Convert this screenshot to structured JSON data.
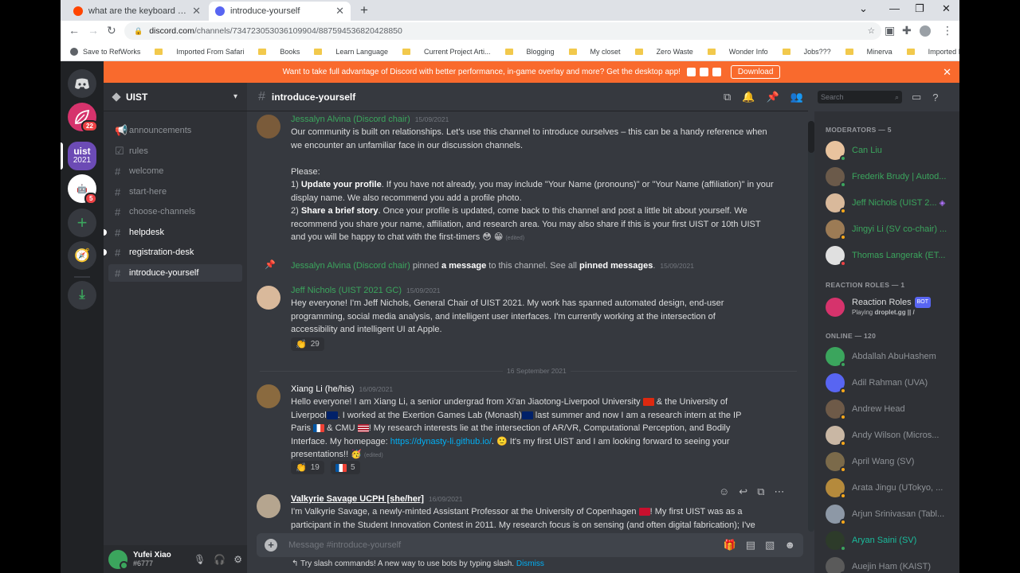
{
  "browser": {
    "tabs": [
      {
        "title": "what are the keyboard short cuts",
        "favicon_color": "#ff4500"
      },
      {
        "title": "introduce-yourself",
        "favicon_color": "#5865f2"
      }
    ],
    "url_host": "discord.com",
    "url_path": "/channels/734723053036109904/887594536820428850",
    "bookmarks": [
      "Save to RefWorks",
      "Imported From Safari",
      "Books",
      "Learn Language",
      "Current Project Arti...",
      "Blogging",
      "My closet",
      "Zero Waste",
      "Wonder Info",
      "Jobs???",
      "Minerva",
      "Imported From Chr..."
    ]
  },
  "banner": {
    "text": "Want to take full advantage of Discord with better performance, in-game overlay and more? Get the desktop app!",
    "download_label": "Download"
  },
  "guilds": {
    "badge_1": "22",
    "uist_line1": "uist",
    "uist_line2": "2021",
    "badge_2": "5"
  },
  "server": {
    "name": "UIST",
    "channels": [
      "announcements",
      "rules",
      "welcome",
      "start-here",
      "choose-channels",
      "helpdesk",
      "registration-desk",
      "introduce-yourself"
    ]
  },
  "user": {
    "name": "Yufei Xiao",
    "tag": "#6777"
  },
  "channel": {
    "name": "introduce-yourself",
    "search_placeholder": "Search"
  },
  "messages": {
    "m1": {
      "author": "Jessalyn Alvina (Discord chair)",
      "ts": "15/09/2021",
      "p1": "Our community is built on relationships. Let's use this channel to introduce ourselves – this can be a handy reference when we encounter an unfamiliar face in our discussion channels.",
      "please": "Please:",
      "i1_num": "1) ",
      "i1_bold": "Update your profile",
      "i1_rest": ". If you have not already, you may include \"Your Name (pronouns)\" or \"Your Name (affiliation)\" in your display name. We also recommend you add a profile photo.",
      "i2_num": "2) ",
      "i2_bold": "Share a brief story",
      "i2_rest": ". Once your profile is updated, come back to this channel and post a little bit about yourself. We recommend you share your name, affiliation, and research area. You may also share if this is your first UIST or 10th UIST and you will be happy to chat with the first-timers ",
      "edited": "(edited)"
    },
    "pin": {
      "author": "Jessalyn Alvina (Discord chair)",
      "t1": " pinned ",
      "a_message": "a message",
      "t2": " to this channel. See all ",
      "pinned_messages": "pinned messages",
      "t3": ".",
      "ts": "15/09/2021"
    },
    "m2": {
      "author": "Jeff Nichols (UIST 2021 GC)",
      "ts": "15/09/2021",
      "text": "Hey everyone!  I'm Jeff Nichols, General Chair of UIST 2021.   My work has spanned automated design, end-user programming, social media analysis, and intelligent user interfaces.  I'm currently working at the intersection of accessibility and intelligent UI at Apple.",
      "reaction_count": "29"
    },
    "divider_label": "16 September 2021",
    "m3": {
      "author": "Xiang Li (he/his)",
      "ts": "16/09/2021",
      "t1": "Hello everyone! I am Xiang Li, a senior undergrad from Xi'an Jiaotong-Liverpool University ",
      "t2": " & the University of Liverpool",
      "t3": ". I worked at the Exertion Games Lab (Monash)",
      "t4": " last summer and now I am a research intern at the IP Paris ",
      "t5": " & CMU ",
      "t6": "! My research interests lie at the intersection of AR/VR, Computational Perception, and Bodily Interface. My homepage: ",
      "link": "https://dynasty-li.github.io/",
      "t7": ". ",
      "t8": " It's my first UIST and I am looking forward to seeing your presentations!! ",
      "edited": "(edited)",
      "r1": "19",
      "r2": "5"
    },
    "m4": {
      "author": "Valkyrie Savage UCPH [she/her]",
      "ts": "16/09/2021",
      "t1": "I'm Valkyrie Savage, a newly-minted Assistant Professor at the University of Copenhagen ",
      "t2": "! My first UIST was as a participant in the Student Innovation Contest in 2011. My research focus is on sensing (and often digital fabrication); I've"
    }
  },
  "composer": {
    "placeholder": "Message #introduce-yourself",
    "tip": "Try slash commands! A new way to use bots by typing slash.",
    "dismiss": "Dismiss"
  },
  "members": {
    "moderators_header": "MODERATORS — 5",
    "moderators": [
      "Can Liu",
      "Frederik Brudy | Autod...",
      "Jeff Nichols (UIST 2...",
      "Jingyi Li (SV co-chair) ...",
      "Thomas Langerak (ET..."
    ],
    "roles_header": "REACTION ROLES — 1",
    "bot_name": "Reaction Roles",
    "bot_badge": "BOT",
    "bot_playing_label": "Playing ",
    "bot_playing_value": "droplet.gg || /",
    "online_header": "ONLINE — 120",
    "online": [
      "Abdallah AbuHashem",
      "Adil Rahman (UVA)",
      "Andrew Head",
      "Andy Wilson (Micros...",
      "April Wang (SV)",
      "Arata Jingu (UTokyo, ...",
      "Arjun Srinivasan (Tabl...",
      "Aryan Saini (SV)",
      "Auejin Ham (KAIST)"
    ]
  }
}
